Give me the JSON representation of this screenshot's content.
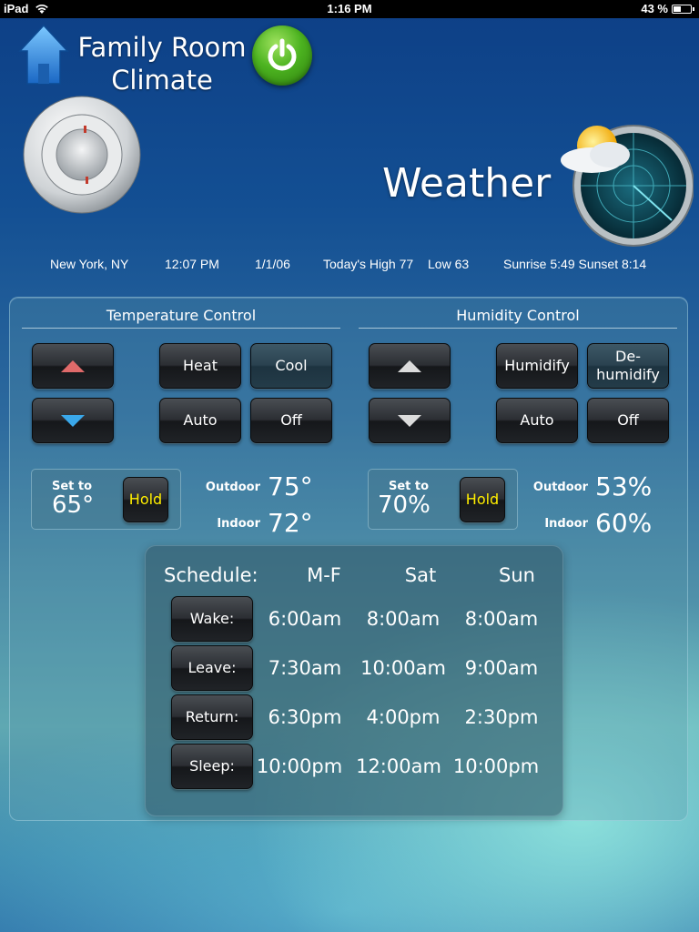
{
  "status_bar": {
    "carrier": "iPad",
    "time": "1:16 PM",
    "battery_text": "43 %",
    "battery_level": 0.43
  },
  "header": {
    "title_line1": "Family Room",
    "title_line2": "Climate",
    "weather_label": "Weather"
  },
  "info": {
    "location": "New York, NY",
    "time": "12:07 PM",
    "date": "1/1/06",
    "high": "Today's High 77",
    "low": "Low 63",
    "sun": "Sunrise 5:49 Sunset 8:14"
  },
  "colors": {
    "up_arrow_temp": "#e06a6a",
    "down_arrow_temp": "#3aa8ea",
    "arrow_humidity": "#dcdcdc",
    "hold_text": "#ffee00",
    "power_green": "#4cb320"
  },
  "temperature": {
    "title": "Temperature Control",
    "modes": {
      "heat": "Heat",
      "cool": "Cool",
      "auto": "Auto",
      "off": "Off"
    },
    "active_mode": "Cool",
    "set_label": "Set to",
    "set_value": "65°",
    "hold": "Hold",
    "outdoor_label": "Outdoor",
    "outdoor_value": "75°",
    "indoor_label": "Indoor",
    "indoor_value": "72°"
  },
  "humidity": {
    "title": "Humidity Control",
    "modes": {
      "humidify": "Humidify",
      "dehumidify_line1": "De-",
      "dehumidify_line2": "humidify",
      "auto": "Auto",
      "off": "Off"
    },
    "active_mode": "De-humidify",
    "set_label": "Set to",
    "set_value": "70%",
    "hold": "Hold",
    "outdoor_label": "Outdoor",
    "outdoor_value": "53%",
    "indoor_label": "Indoor",
    "indoor_value": "60%"
  },
  "schedule": {
    "label": "Schedule:",
    "columns": [
      "M-F",
      "Sat",
      "Sun"
    ],
    "rows": [
      {
        "event": "Wake:",
        "times": [
          "6:00am",
          "8:00am",
          "8:00am"
        ]
      },
      {
        "event": "Leave:",
        "times": [
          "7:30am",
          "10:00am",
          "9:00am"
        ]
      },
      {
        "event": "Return:",
        "times": [
          "6:30pm",
          "4:00pm",
          "2:30pm"
        ]
      },
      {
        "event": "Sleep:",
        "times": [
          "10:00pm",
          "12:00am",
          "10:00pm"
        ]
      }
    ]
  }
}
